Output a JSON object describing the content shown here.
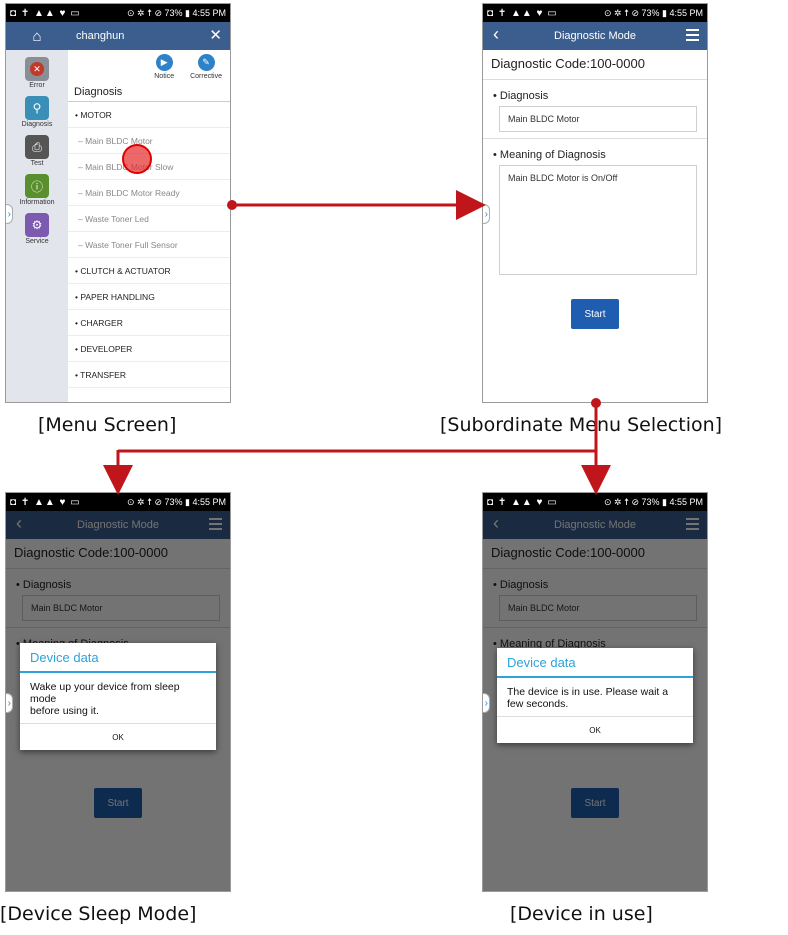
{
  "status_bar": {
    "left_icons": "◘ ✝ ▲▲ ♥ ▭",
    "right_text": "⊙ ✲ ☨ ⊘ 73% ▮ 4:55 PM"
  },
  "menu_screen": {
    "user": "changhun",
    "sidebar": [
      {
        "label": "Error",
        "icon": "error-icon",
        "color": "#c0392b"
      },
      {
        "label": "Diagnosis",
        "icon": "search-icon",
        "color": "#3a8fb7"
      },
      {
        "label": "Test",
        "icon": "printer-icon",
        "color": "#555555"
      },
      {
        "label": "Information",
        "icon": "info-icon",
        "color": "#5a8f2e"
      },
      {
        "label": "Service",
        "icon": "gear-icon",
        "color": "#7b5ab0"
      }
    ],
    "tools": [
      {
        "label": "Notice"
      },
      {
        "label": "Corrective"
      }
    ],
    "section_title": "Diagnosis",
    "items": [
      {
        "text": "• MOTOR",
        "kind": "cat"
      },
      {
        "text": "– Main BLDC Motor",
        "kind": "sub"
      },
      {
        "text": "– Main BLDC Motor Slow",
        "kind": "sub"
      },
      {
        "text": "– Main BLDC Motor Ready",
        "kind": "sub"
      },
      {
        "text": "– Waste Toner Led",
        "kind": "sub"
      },
      {
        "text": "– Waste Toner Full Sensor",
        "kind": "sub"
      },
      {
        "text": "• CLUTCH & ACTUATOR",
        "kind": "cat"
      },
      {
        "text": "• PAPER HANDLING",
        "kind": "cat"
      },
      {
        "text": "• CHARGER",
        "kind": "cat"
      },
      {
        "text": "• DEVELOPER",
        "kind": "cat"
      },
      {
        "text": "• TRANSFER",
        "kind": "cat"
      }
    ]
  },
  "detail": {
    "title": "Diagnostic Mode",
    "code": "Diagnostic Code:100-0000",
    "diagnosis_label": "• Diagnosis",
    "diagnosis_value": "Main BLDC Motor",
    "meaning_label": "• Meaning of Diagnosis",
    "meaning_value": "Main BLDC Motor is On/Off",
    "start": "Start"
  },
  "dialog_sleep": {
    "title": "Device data",
    "message_lines": [
      "Wake up your device from sleep",
      "mode",
      "before using it."
    ],
    "ok": "OK"
  },
  "dialog_in_use": {
    "title": "Device data",
    "message_lines": [
      "The device is in use. Please wait a",
      "few seconds."
    ],
    "ok": "OK"
  },
  "captions": {
    "menu": "[Menu Screen]",
    "subordinate": "[Subordinate Menu Selection]",
    "sleep": "[Device Sleep Mode]",
    "in_use": "[Device in use]"
  },
  "colors": {
    "arrow": "#c0161b",
    "appbar": "#3b5e8f",
    "dialog_accent": "#2ea3d9",
    "start_button": "#1e5db0"
  }
}
